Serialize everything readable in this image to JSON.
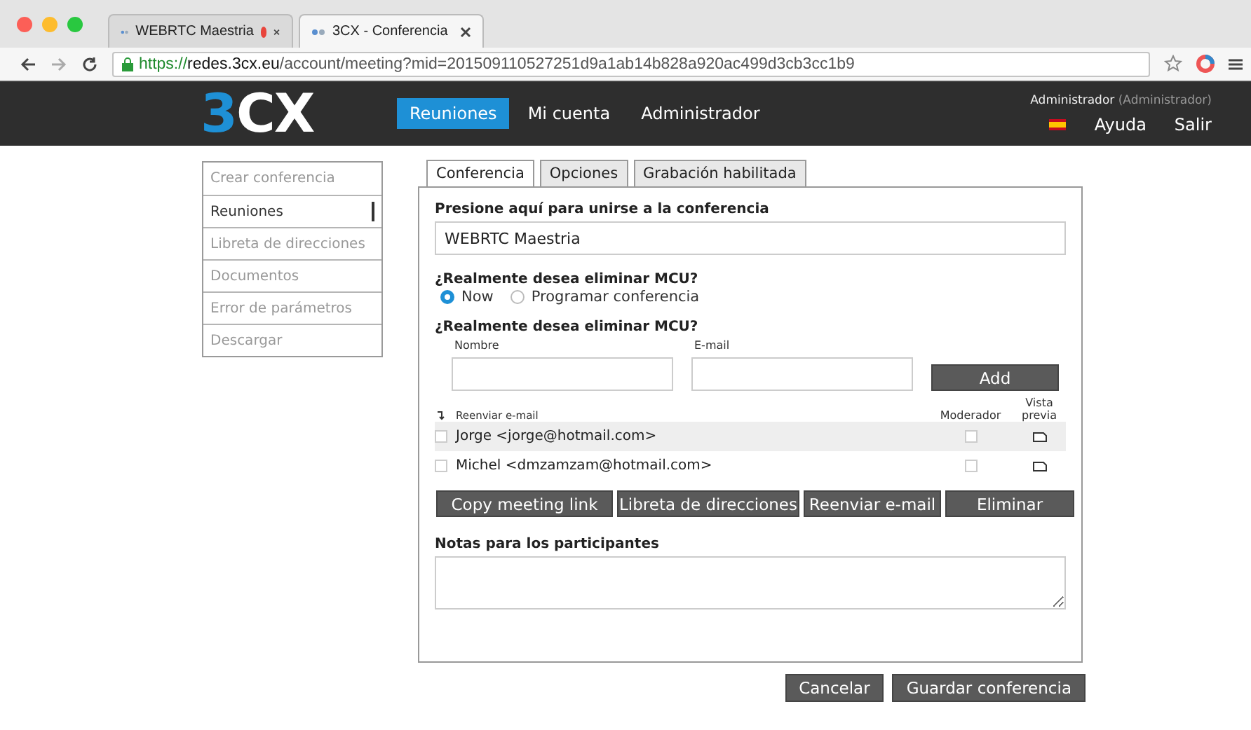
{
  "browser": {
    "tabs": [
      {
        "title": "WEBRTC Maestria",
        "selected": false,
        "recording": true
      },
      {
        "title": "3CX - Conferencia",
        "selected": true,
        "recording": false
      }
    ],
    "url": {
      "scheme": "https://",
      "host": "redes.3cx.eu",
      "path": "/account/meeting?mid=201509110527251d9a1ab14b828a920ac499d3cb3cc1b9"
    }
  },
  "header": {
    "logo": {
      "lead": "3",
      "rest": "CX"
    },
    "nav": [
      {
        "label": "Reuniones",
        "selected": true
      },
      {
        "label": "Mi cuenta",
        "selected": false
      },
      {
        "label": "Administrador",
        "selected": false
      }
    ],
    "user": "Administrador",
    "role": "(Administrador)",
    "links": [
      "Ayuda",
      "Salir"
    ]
  },
  "sidebar": {
    "items": [
      {
        "label": "Crear conferencia",
        "selected": false
      },
      {
        "label": "Reuniones",
        "selected": true
      },
      {
        "label": "Libreta de direcciones",
        "selected": false
      },
      {
        "label": "Documentos",
        "selected": false
      },
      {
        "label": "Error de parámetros",
        "selected": false
      },
      {
        "label": "Descargar",
        "selected": false
      }
    ]
  },
  "tabs": [
    {
      "label": "Conferencia",
      "selected": true
    },
    {
      "label": "Opciones",
      "selected": false
    },
    {
      "label": "Grabación habilitada",
      "selected": false
    }
  ],
  "form": {
    "join_label": "Presione aquí para unirse a la conferencia",
    "join_value": "WEBRTC Maestria",
    "schedule_label": "¿Realmente desea eliminar MCU?",
    "schedule_options": [
      {
        "label": "Now",
        "selected": true
      },
      {
        "label": "Programar conferencia",
        "selected": false
      }
    ],
    "participants_label": "¿Realmente desea eliminar MCU?",
    "name_label": "Nombre",
    "email_label": "E-mail",
    "add_button": "Add",
    "columns": {
      "resend": "Reenviar e-mail",
      "moderator": "Moderador",
      "preview": "Vista previa"
    },
    "participants": [
      {
        "name": "Jorge <jorge@hotmail.com>",
        "checked": false,
        "moderator": false
      },
      {
        "name": "Michel <dmzamzam@hotmail.com>",
        "checked": false,
        "moderator": false
      }
    ],
    "actions": [
      "Copy meeting link",
      "Libreta de direcciones",
      "Reenviar e-mail",
      "Eliminar"
    ],
    "notes_label": "Notas para los participantes"
  },
  "footer_buttons": [
    "Cancelar",
    "Guardar conferencia"
  ]
}
